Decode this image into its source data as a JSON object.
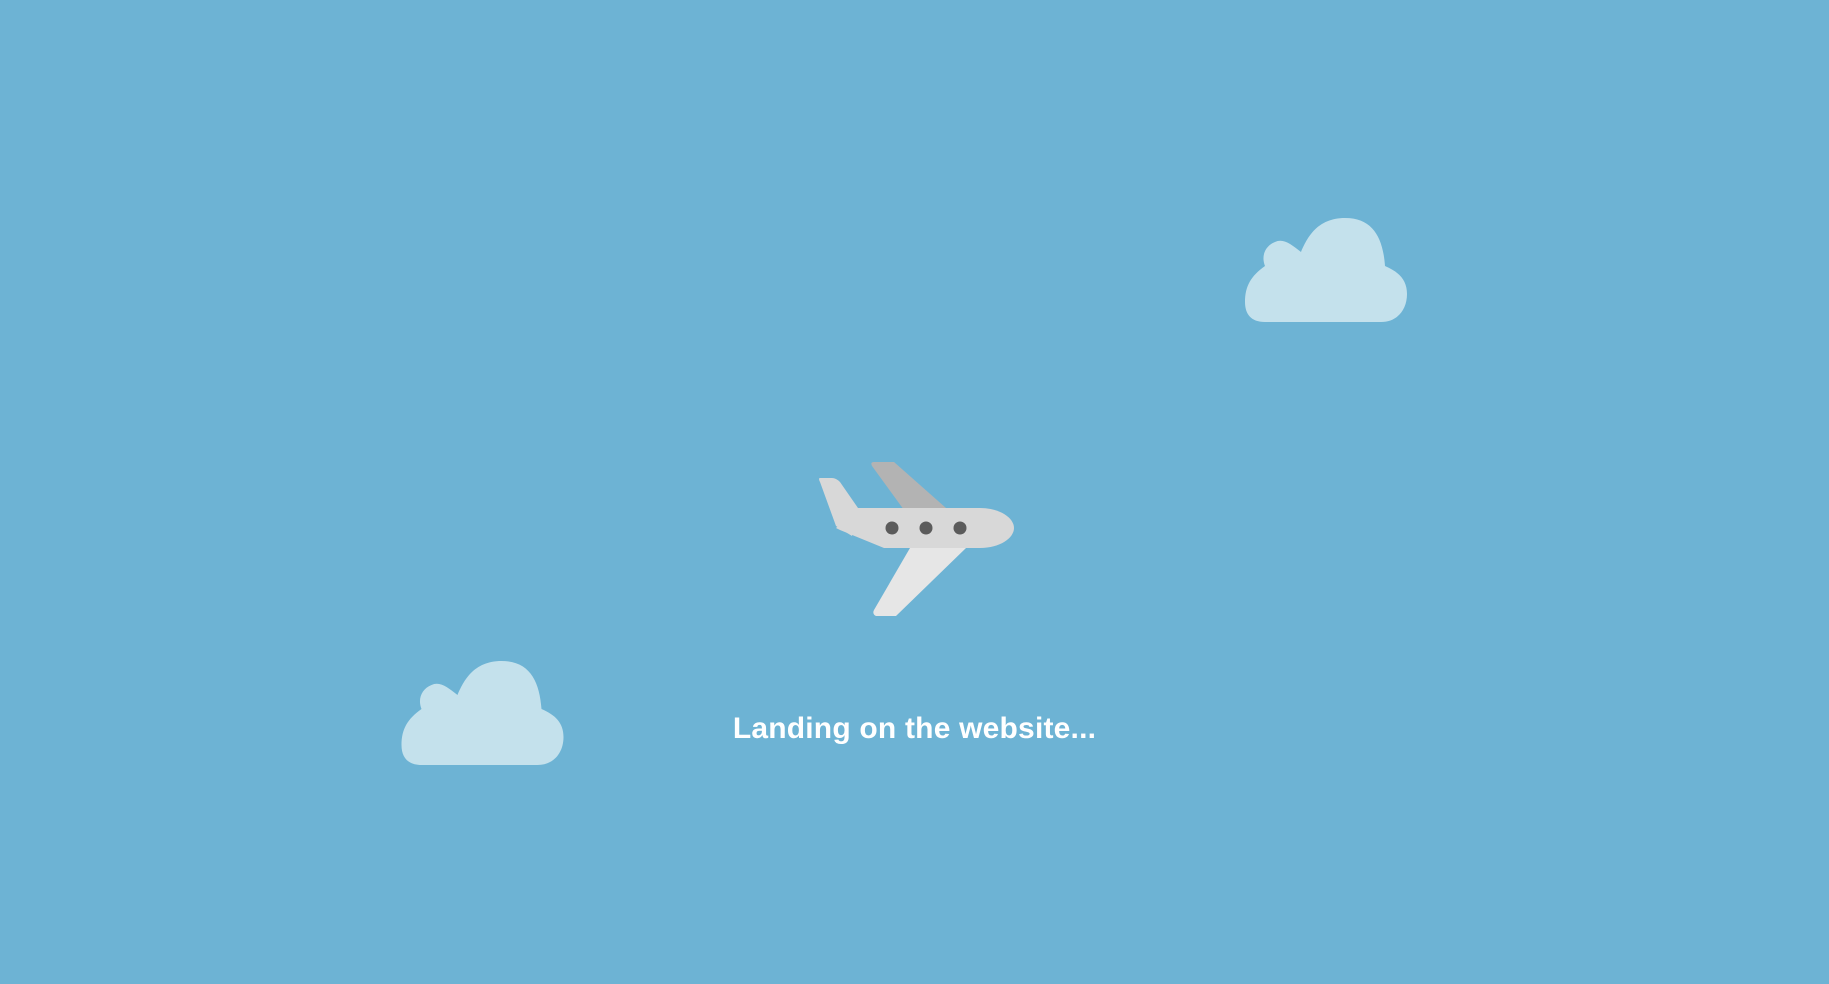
{
  "loader": {
    "message": "Landing on the website..."
  },
  "colors": {
    "background": "#6db3d4",
    "cloud": "#c4e1ec",
    "plane_body": "#d8d8d8",
    "plane_wing_top": "#b3b3b3",
    "plane_wing_bottom": "#e6e6e6",
    "plane_window": "#5b5b5b",
    "text": "#ffffff"
  },
  "icons": {
    "plane": "airplane-icon",
    "cloud": "cloud-icon"
  }
}
